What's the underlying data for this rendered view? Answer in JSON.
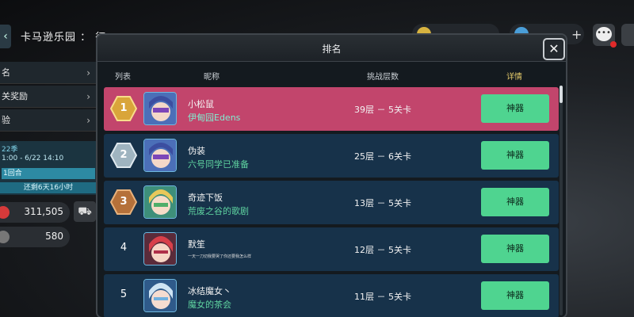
{
  "zone": {
    "title": "卡马逊乐园 ： 征"
  },
  "side_menu": {
    "items": [
      {
        "label": "名"
      },
      {
        "label": "关奖励"
      },
      {
        "label": "验"
      }
    ],
    "event": {
      "season": "22季",
      "dates": "1:00 - 6/22 14:10",
      "round": "1回合",
      "countdown": "还剩6天16小时"
    },
    "stats": {
      "gems": "311,505",
      "cash": "580"
    }
  },
  "modal": {
    "title": "排名",
    "columns": {
      "rank": "列表",
      "nickname": "昵称",
      "floors": "挑战层数",
      "detail": "详情"
    },
    "rows": [
      {
        "rank": "1",
        "name": "小松鼠",
        "subtitle": "伊甸园Edens",
        "floors": "39层 － 5关卡",
        "button": "神器"
      },
      {
        "rank": "2",
        "name": "伪装",
        "subtitle": "六号同学已准备",
        "floors": "25层 － 6关卡",
        "button": "神器"
      },
      {
        "rank": "3",
        "name": "奇迹下饭",
        "subtitle": "荒废之谷的歌剧",
        "floors": "13层 － 5关卡",
        "button": "神器"
      },
      {
        "rank": "4",
        "name": "默笙",
        "subtitle": "一天一刀切我要哭了你还要我怎么样",
        "floors": "12层 － 5关卡",
        "button": "神器"
      },
      {
        "rank": "5",
        "name": "冰结魔女丶",
        "subtitle": "魔女的茶会",
        "floors": "11层 － 5关卡",
        "button": "神器"
      }
    ]
  },
  "colors": {
    "first_row": "#c2456c",
    "row": "#17324a",
    "button": "#4fd490",
    "gold": "#d9a53a",
    "silver": "#9fb4c0",
    "bronze": "#b5713a"
  }
}
